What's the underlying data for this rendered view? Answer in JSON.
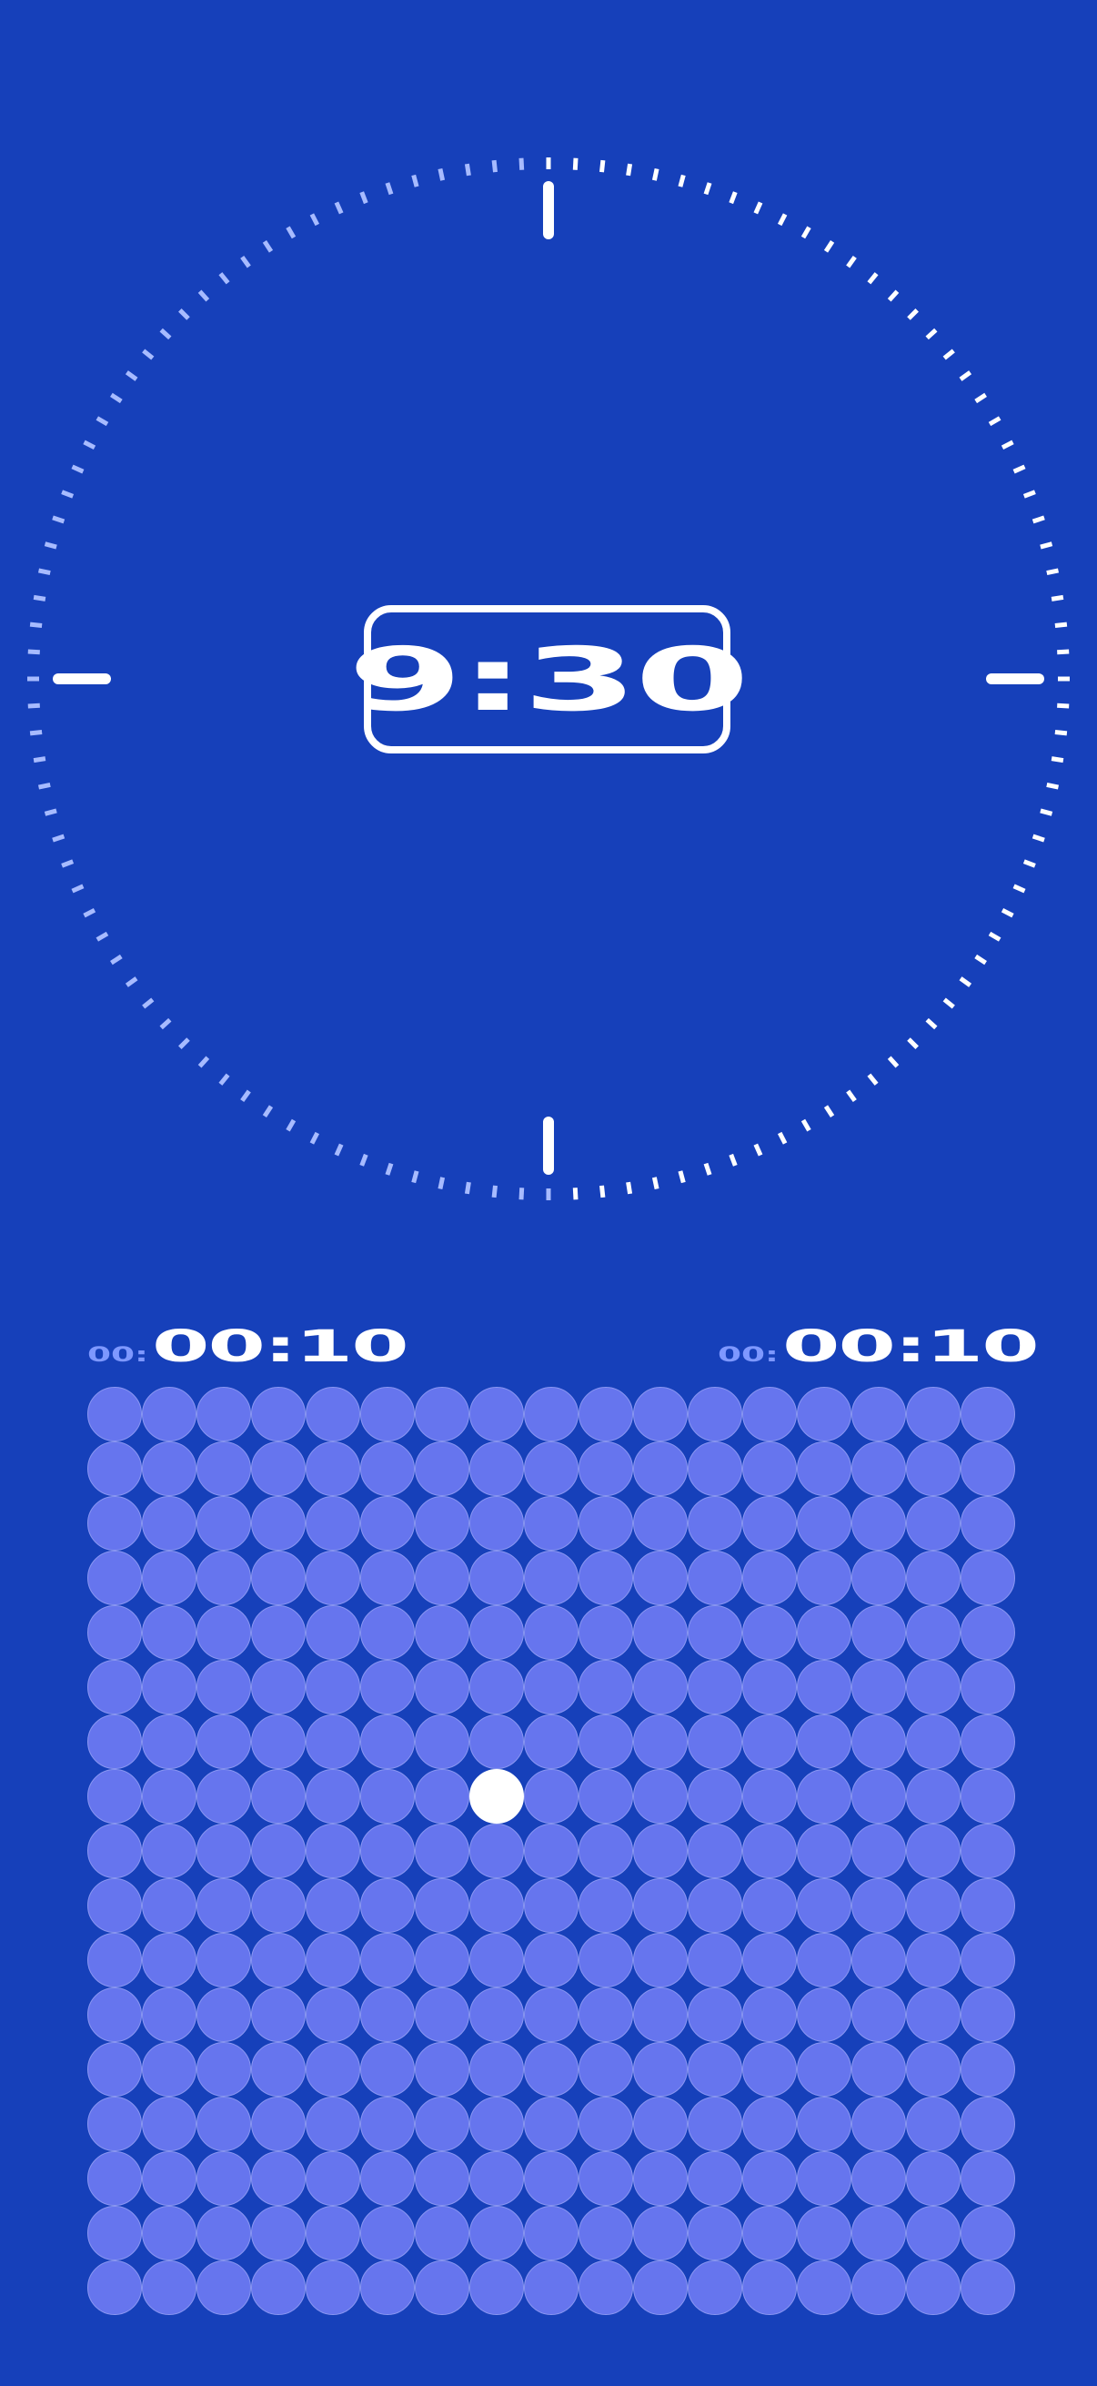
{
  "clock": {
    "time": "9:30",
    "progress_fraction": 0.5,
    "tick_count": 120,
    "colors": {
      "tick_active": "#FFFFFF",
      "tick_inactive": "#A7BBFF",
      "hour_marker": "#FFFFFF"
    },
    "hour_markers": [
      "12",
      "3",
      "6",
      "9"
    ]
  },
  "timers": {
    "left": {
      "prefix": "00:",
      "value": "00:10"
    },
    "right": {
      "prefix": "00:",
      "value": "00:10"
    }
  },
  "grid": {
    "rows": 17,
    "columns": 17,
    "active_cell": {
      "row": 7,
      "column": 7
    },
    "colors": {
      "dot": "#6675EE",
      "dot_border": "#8A96F2",
      "active_dot": "#FFFFFF"
    }
  },
  "colors": {
    "background": "#1640BA"
  }
}
